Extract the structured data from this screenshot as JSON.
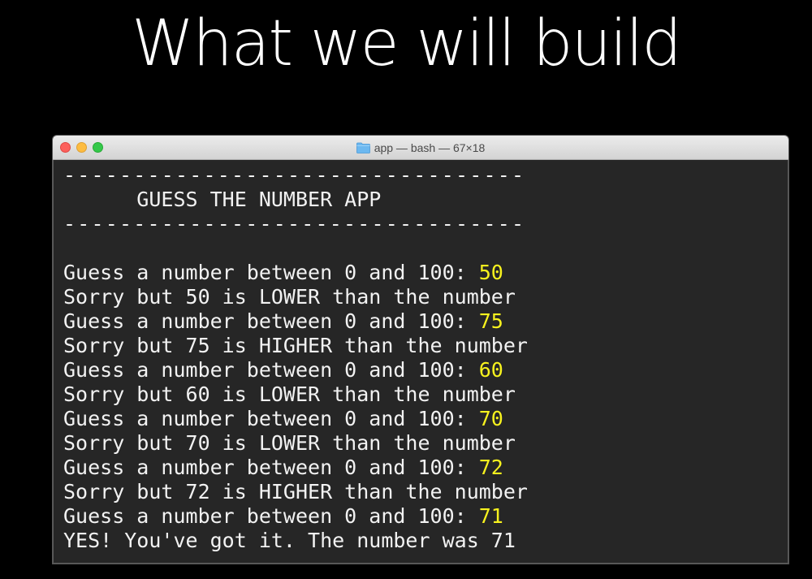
{
  "slide": {
    "title": "What we will build"
  },
  "window": {
    "title": "app — bash — 67×18",
    "title_icon": "folder-icon",
    "traffic_lights": {
      "close": "#fc605c",
      "minimize": "#fdbc40",
      "zoom": "#34c84a"
    }
  },
  "colors": {
    "terminal_bg": "#262626",
    "terminal_text": "#f2f2f2",
    "input_text": "#f7f21e"
  },
  "terminal": {
    "header_rule_top": "---------------------------------",
    "header_title": "      GUESS THE NUMBER APP",
    "header_rule_bottom": "---------------------------------",
    "lines": [
      {
        "text": "Guess a number between 0 and 100: ",
        "input": "50"
      },
      {
        "text": "Sorry but 50 is LOWER than the number",
        "input": ""
      },
      {
        "text": "Guess a number between 0 and 100: ",
        "input": "75"
      },
      {
        "text": "Sorry but 75 is HIGHER than the number",
        "input": ""
      },
      {
        "text": "Guess a number between 0 and 100: ",
        "input": "60"
      },
      {
        "text": "Sorry but 60 is LOWER than the number",
        "input": ""
      },
      {
        "text": "Guess a number between 0 and 100: ",
        "input": "70"
      },
      {
        "text": "Sorry but 70 is LOWER than the number",
        "input": ""
      },
      {
        "text": "Guess a number between 0 and 100: ",
        "input": "72"
      },
      {
        "text": "Sorry but 72 is HIGHER than the number",
        "input": ""
      },
      {
        "text": "Guess a number between 0 and 100: ",
        "input": "71"
      },
      {
        "text": "YES! You've got it. The number was 71",
        "input": ""
      }
    ]
  }
}
